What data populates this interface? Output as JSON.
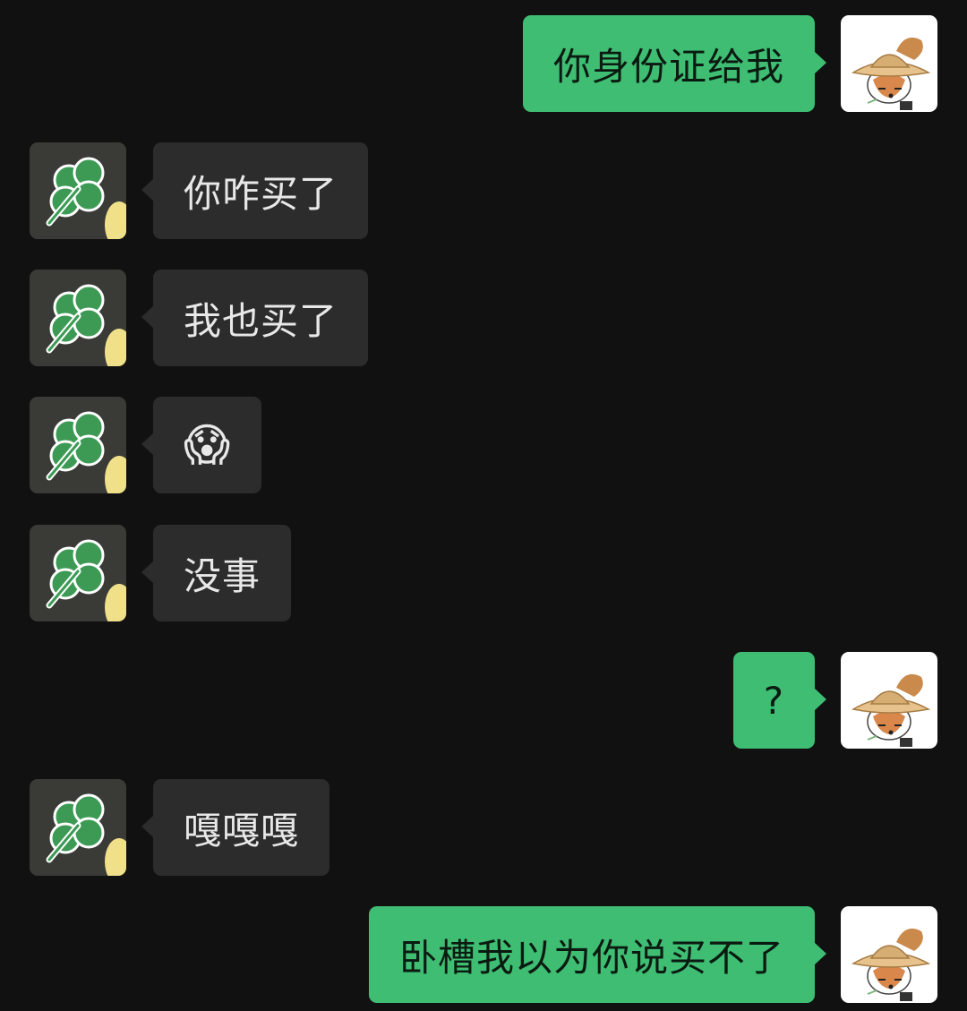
{
  "colors": {
    "background": "#111111",
    "incoming_bubble": "#2c2c2c",
    "outgoing_bubble": "#3ebd73",
    "incoming_text": "#e8e8e8",
    "outgoing_text": "#0b1a10"
  },
  "avatars": {
    "contact": "clover-avatar",
    "self": "straw-hat-dog-avatar"
  },
  "messages": [
    {
      "side": "outgoing",
      "text": "你身份证给我"
    },
    {
      "side": "incoming",
      "text": "你咋买了"
    },
    {
      "side": "incoming",
      "text": "我也买了"
    },
    {
      "side": "incoming",
      "text": "😱",
      "emoji_name": "face-screaming-in-fear"
    },
    {
      "side": "incoming",
      "text": "没事"
    },
    {
      "side": "outgoing",
      "text": "?"
    },
    {
      "side": "incoming",
      "text": "嘎嘎嘎"
    },
    {
      "side": "outgoing",
      "text": "卧槽我以为你说买不了"
    }
  ]
}
